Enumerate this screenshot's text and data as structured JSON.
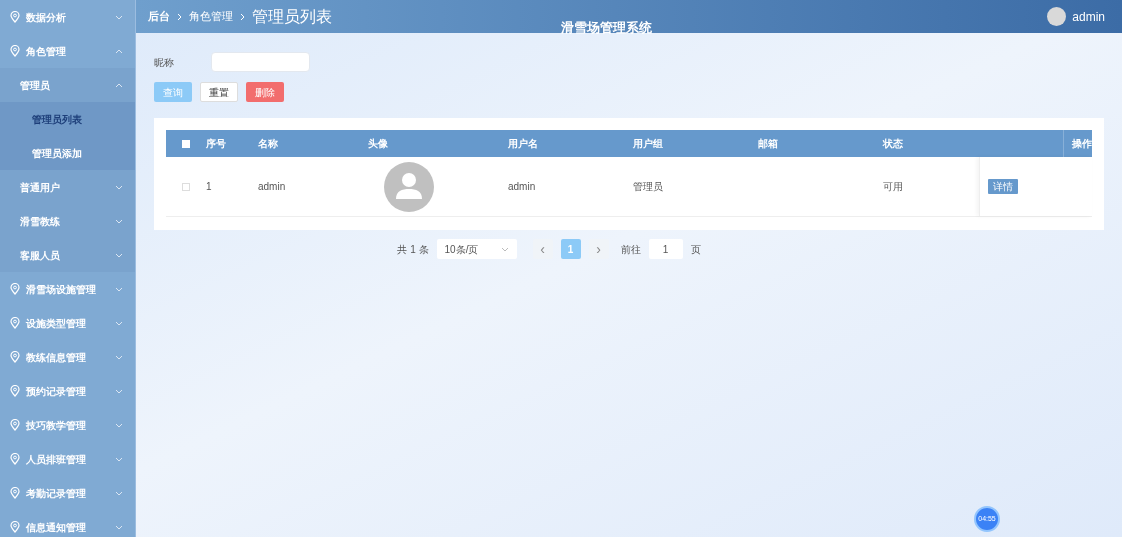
{
  "sidebar": {
    "items": [
      {
        "label": "数据分析",
        "expanded": false
      },
      {
        "label": "角色管理",
        "expanded": true,
        "children": [
          {
            "label": "管理员",
            "expanded": true,
            "children": [
              {
                "label": "管理员列表",
                "selected": true
              },
              {
                "label": "管理员添加",
                "selected": false
              }
            ]
          },
          {
            "label": "普通用户",
            "expanded": false
          },
          {
            "label": "滑雪教练",
            "expanded": false
          },
          {
            "label": "客服人员",
            "expanded": false
          }
        ]
      },
      {
        "label": "滑雪场设施管理",
        "expanded": false
      },
      {
        "label": "设施类型管理",
        "expanded": false
      },
      {
        "label": "教练信息管理",
        "expanded": false
      },
      {
        "label": "预约记录管理",
        "expanded": false
      },
      {
        "label": "技巧教学管理",
        "expanded": false
      },
      {
        "label": "人员排班管理",
        "expanded": false
      },
      {
        "label": "考勤记录管理",
        "expanded": false
      },
      {
        "label": "信息通知管理",
        "expanded": false
      }
    ]
  },
  "header": {
    "breadcrumb": [
      "后台",
      "角色管理"
    ],
    "page_title": "管理员列表",
    "system_title": "滑雪场管理系统",
    "user": "admin"
  },
  "search": {
    "label": "昵称"
  },
  "buttons": [
    {
      "label": "查询",
      "kind": "primary"
    },
    {
      "label": "重置",
      "kind": "plain"
    },
    {
      "label": "删除",
      "kind": "danger"
    }
  ],
  "table": {
    "header_checked": false,
    "columns": [
      "序号",
      "名称",
      "头像",
      "用户名",
      "用户组",
      "邮箱",
      "状态",
      "操作"
    ],
    "rows": [
      {
        "checked": false,
        "index": "1",
        "name": "admin",
        "username": "admin",
        "group": "管理员",
        "status": "可用",
        "action": "详情"
      }
    ]
  },
  "pagination": {
    "total": "共 1 条",
    "page_size": "10条/页",
    "prev": "‹",
    "pages": [
      {
        "label": "1",
        "selected": true
      }
    ],
    "next": "›",
    "goto_label": "前往",
    "goto_value": "1",
    "page_unit": "页"
  },
  "timer": "04:55"
}
